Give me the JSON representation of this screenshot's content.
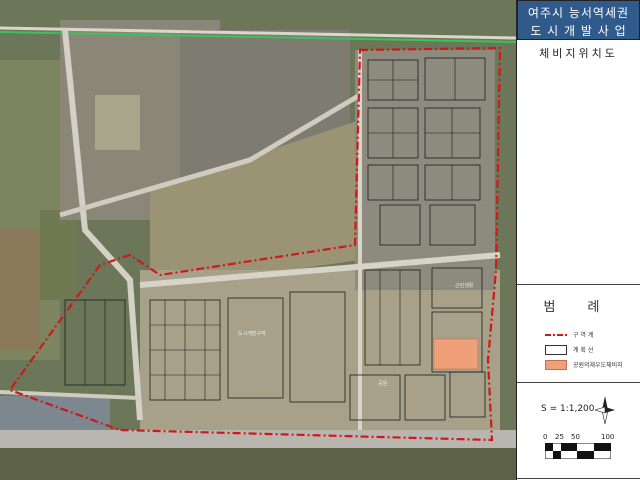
{
  "title": {
    "line1": "여주시 능서역세권",
    "line2": "도 시 개 발 사 업"
  },
  "subtitle": "체비지위치도",
  "legend": {
    "title": "범 례",
    "items": [
      {
        "label": "구   역   계",
        "symbol": "boundary-line",
        "color": "#d01818"
      },
      {
        "label": "계   획   선",
        "symbol": "plan-line",
        "color": "#333333"
      },
      {
        "label": "공원의재우도체비지",
        "symbol": "site-fill",
        "color": "#f0a078"
      }
    ]
  },
  "scale": {
    "text": "S = 1:1,200",
    "ticks": [
      "0",
      "25",
      "50",
      "100"
    ]
  },
  "colors": {
    "boundary": "#d01818",
    "highway": "#3fbf5a",
    "site": "#f0a078",
    "title_bg": "#2f5a8a"
  },
  "map": {
    "labels": [
      "도시개발구역",
      "공원",
      "근린생활"
    ]
  }
}
